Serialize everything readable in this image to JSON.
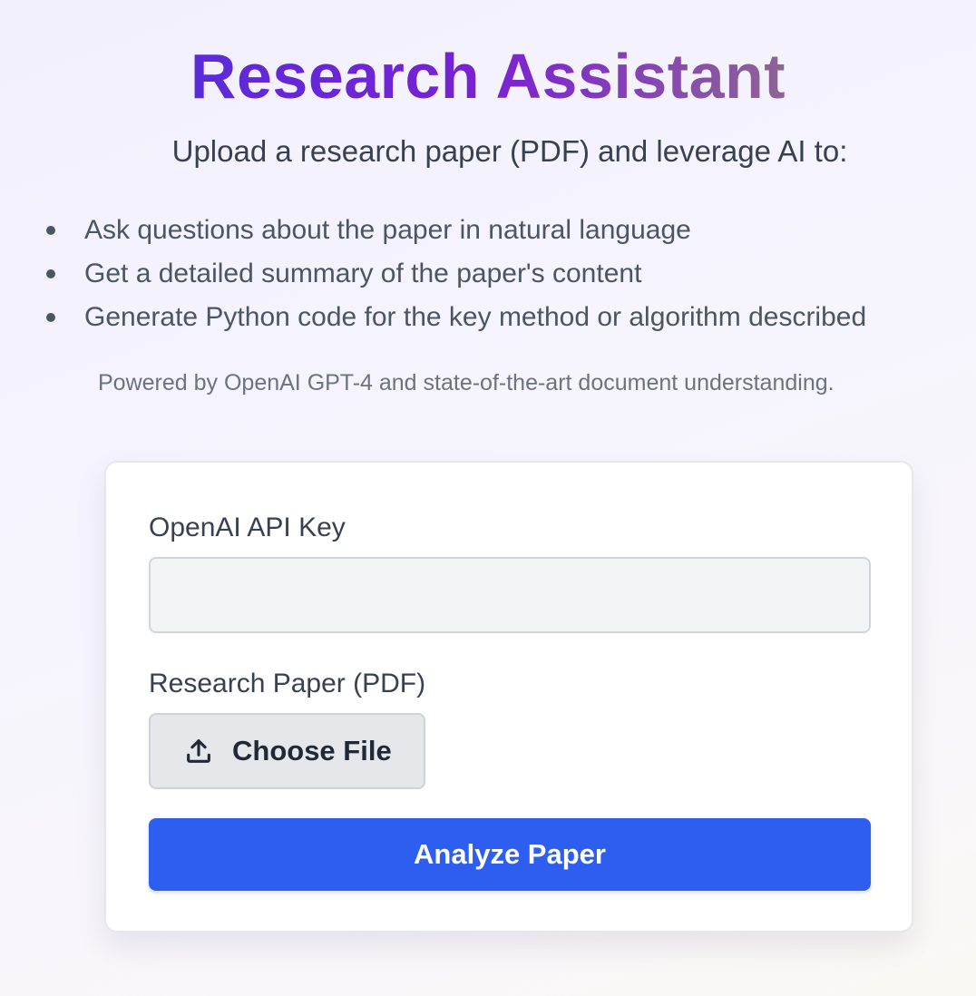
{
  "header": {
    "title": "Research Assistant",
    "subtitle": "Upload a research paper (PDF) and leverage AI to:"
  },
  "features": [
    "Ask questions about the paper in natural language",
    "Get a detailed summary of the paper's content",
    "Generate Python code for the key method or algorithm described"
  ],
  "powered_by": "Powered by OpenAI GPT-4 and state-of-the-art document understanding.",
  "form": {
    "api_key_label": "OpenAI API Key",
    "api_key_value": "",
    "api_key_placeholder": "",
    "pdf_label": "Research Paper (PDF)",
    "choose_file_label": "Choose File",
    "choose_file_icon": "upload-icon",
    "submit_label": "Analyze Paper"
  },
  "colors": {
    "title_gradient": [
      "#5b2bd9",
      "#7a21d4",
      "#8e6494"
    ],
    "primary_button": "#2d5ef0",
    "input_background": "#f3f4f6"
  }
}
